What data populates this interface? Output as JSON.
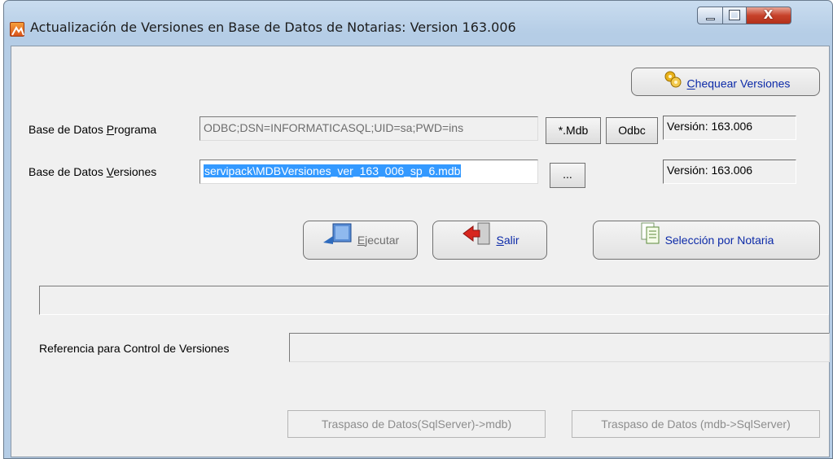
{
  "window": {
    "title": "Actualización de Versiones en Base de Datos de Notarias: Version 163.006",
    "close_label": "X"
  },
  "toolbar": {
    "check_versions_label_u": "C",
    "check_versions_label_rest": "hequear Versiones"
  },
  "program_db": {
    "label_pre": "Base de Datos ",
    "label_u": "P",
    "label_post": "rograma",
    "value": "ODBC;DSN=INFORMATICASQL;UID=sa;PWD=ins",
    "mdb_button": "*.Mdb",
    "odbc_button": "Odbc",
    "version": "Versión: 163.006"
  },
  "versions_db": {
    "label_pre": "Base de Datos ",
    "label_u": "V",
    "label_post": "ersiones",
    "value": "servipack\\MDBVersiones_ver_163_006_sp_6.mdb",
    "browse_button": "...",
    "version": "Versión: 163.006"
  },
  "actions": {
    "execute_u": "E",
    "execute_rest": "jecutar",
    "exit_u": "S",
    "exit_rest": "alir",
    "select_notary": "Selección por Notaria"
  },
  "progress": {
    "value": 0
  },
  "reference": {
    "label": "Referencia para Control de Versiones",
    "value": ""
  },
  "transfer": {
    "sql_to_mdb": "Traspaso de Datos(SqlServer)->mdb)",
    "mdb_to_sql": "Traspaso de Datos (mdb->SqlServer)"
  },
  "colors": {
    "title_gradient": "#c2d6ec",
    "selection": "#3399ff",
    "link_blue": "#0c2aa8"
  }
}
